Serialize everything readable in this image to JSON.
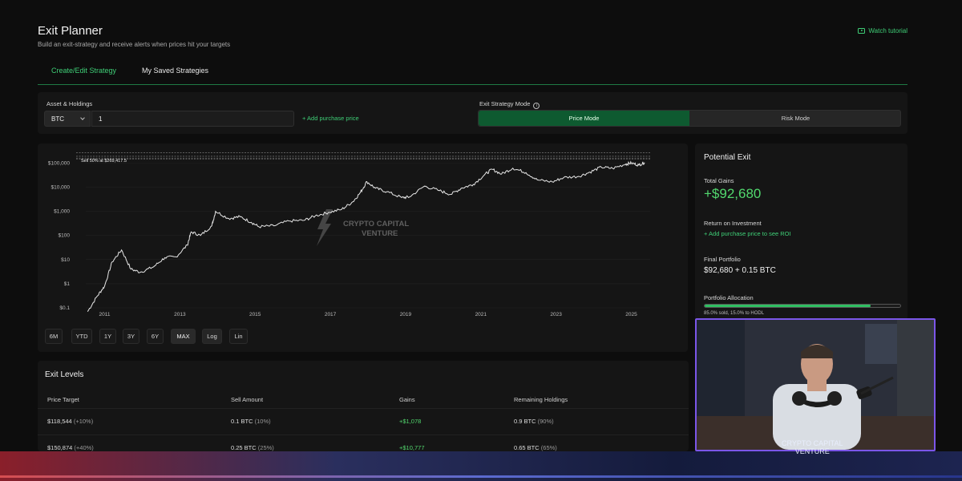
{
  "header": {
    "title": "Exit Planner",
    "subtitle": "Build an exit-strategy and receive alerts when prices hit your targets",
    "tutorial_label": "Watch tutorial"
  },
  "tabs": [
    {
      "label": "Create/Edit Strategy",
      "active": true
    },
    {
      "label": "My Saved Strategies",
      "active": false
    }
  ],
  "asset": {
    "section_label": "Asset & Holdings",
    "selected": "BTC",
    "quantity": "1",
    "add_purchase_label": "+ Add purchase price"
  },
  "mode": {
    "section_label": "Exit Strategy Mode",
    "options": [
      "Price Mode",
      "Risk Mode"
    ],
    "selected": "Price Mode"
  },
  "chart": {
    "watermark_line1": "CRYPTO CAPITAL",
    "watermark_line2": "VENTURE",
    "target_label": "Sell 50% at $269,417.5",
    "range_buttons": [
      "6M",
      "YTD",
      "1Y",
      "3Y",
      "6Y",
      "MAX"
    ],
    "range_selected": "MAX",
    "scale_buttons": [
      "Log",
      "Lin"
    ],
    "scale_selected": "Log"
  },
  "chart_data": {
    "type": "line",
    "yscale": "log",
    "ylim": [
      0.1,
      300000
    ],
    "xlim": [
      2010.5,
      2025.5
    ],
    "yticks": [
      "$100,000",
      "$10,000",
      "$1,000",
      "$100",
      "$10",
      "$1",
      "$0.1"
    ],
    "ytick_values": [
      100000,
      10000,
      1000,
      100,
      10,
      1,
      0.1
    ],
    "xticks": [
      "2011",
      "2013",
      "2015",
      "2017",
      "2019",
      "2021",
      "2023",
      "2025"
    ],
    "xtick_values": [
      2011,
      2013,
      2015,
      2017,
      2019,
      2021,
      2023,
      2025
    ],
    "target_lines": [
      145000,
      160000,
      190000,
      269417.5
    ],
    "series": [
      {
        "color": "#e8e8e8",
        "x": [
          2010.55,
          2010.8,
          2011.0,
          2011.2,
          2011.45,
          2011.7,
          2011.95,
          2012.3,
          2012.6,
          2012.9,
          2013.2,
          2013.3,
          2013.55,
          2013.85,
          2013.95,
          2014.3,
          2014.6,
          2014.9,
          2015.1,
          2015.5,
          2015.9,
          2016.3,
          2016.6,
          2016.95,
          2017.3,
          2017.6,
          2017.8,
          2017.97,
          2018.2,
          2018.5,
          2018.9,
          2019.1,
          2019.5,
          2019.9,
          2020.2,
          2020.5,
          2020.8,
          2021.1,
          2021.3,
          2021.55,
          2021.85,
          2022.2,
          2022.5,
          2022.9,
          2023.2,
          2023.6,
          2023.9,
          2024.2,
          2024.5,
          2024.85,
          2025.0,
          2025.2,
          2025.35
        ],
        "y": [
          0.07,
          0.3,
          0.8,
          8,
          25,
          4,
          3,
          5,
          12,
          13,
          40,
          140,
          100,
          250,
          1000,
          500,
          600,
          350,
          230,
          250,
          400,
          420,
          650,
          900,
          1200,
          2500,
          6000,
          17000,
          9000,
          6500,
          3700,
          3900,
          11000,
          7200,
          5000,
          9300,
          13000,
          33000,
          55000,
          35000,
          61000,
          40000,
          20000,
          16500,
          25000,
          28000,
          42000,
          68000,
          60000,
          90000,
          100000,
          82000,
          105000
        ]
      }
    ]
  },
  "potential_exit": {
    "title": "Potential Exit",
    "total_gains_label": "Total Gains",
    "total_gains_value": "+$92,680",
    "roi_label": "Return on Investment",
    "roi_link": "+ Add purchase price to see ROI",
    "final_portfolio_label": "Final Portfolio",
    "final_portfolio_value": "$92,680 + 0.15 BTC",
    "allocation_label": "Portfolio Allocation",
    "allocation_sold_pct": 85,
    "allocation_caption": "85.0% sold, 15.0% to HODL"
  },
  "exit_levels": {
    "title": "Exit Levels",
    "columns": [
      "Price Target",
      "Sell Amount",
      "Gains",
      "Remaining Holdings"
    ],
    "rows": [
      {
        "price": "$118,544",
        "price_pct": "(+10%)",
        "sell": "0.1 BTC",
        "sell_pct": "(10%)",
        "gains": "+$1,078",
        "remaining": "0.9 BTC",
        "remaining_pct": "(90%)"
      },
      {
        "price": "$150,874",
        "price_pct": "(+40%)",
        "sell": "0.25 BTC",
        "sell_pct": "(25%)",
        "gains": "+$10,777",
        "remaining": "0.65 BTC",
        "remaining_pct": "(65%)"
      }
    ]
  },
  "stream": {
    "logo_line1": "CRYPTO CAPITAL",
    "logo_line2": "VENTURE"
  }
}
